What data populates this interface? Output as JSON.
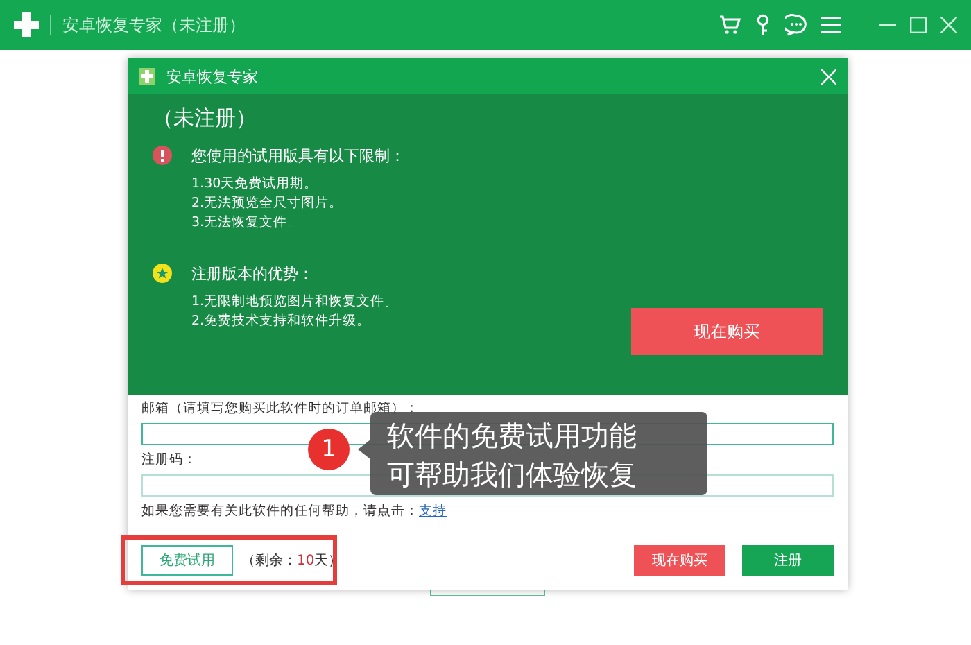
{
  "window": {
    "title": "安卓恢复专家（未注册）"
  },
  "dialog": {
    "title": "安卓恢复专家",
    "status": "（未注册）",
    "sections": [
      {
        "kind": "warning",
        "heading": "您使用的试用版具有以下限制：",
        "items": [
          "1.30天免费试用期。",
          "2.无法预览全尺寸图片。",
          "3.无法恢复文件。"
        ]
      },
      {
        "kind": "star",
        "heading": "注册版本的优势：",
        "items": [
          "1.无限制地预览图片和恢复文件。",
          "2.免费技术支持和软件升级。"
        ]
      }
    ],
    "buy_button": "现在购买",
    "email_label": "邮箱（请填写您购买此软件时的订单邮箱）：",
    "code_label": "注册码：",
    "help_text": "如果您需要有关此软件的任何帮助，请点击：",
    "help_link": "支持",
    "trial_button": "免费试用",
    "remaining_prefix": "（剩余：",
    "remaining_days": "10",
    "remaining_suffix": "天）",
    "footer_buy_button": "现在购买",
    "register_button": "注册"
  },
  "callout": {
    "number": "1",
    "lines": [
      "软件的免费试用功能",
      "可帮助我们体验恢复"
    ]
  }
}
